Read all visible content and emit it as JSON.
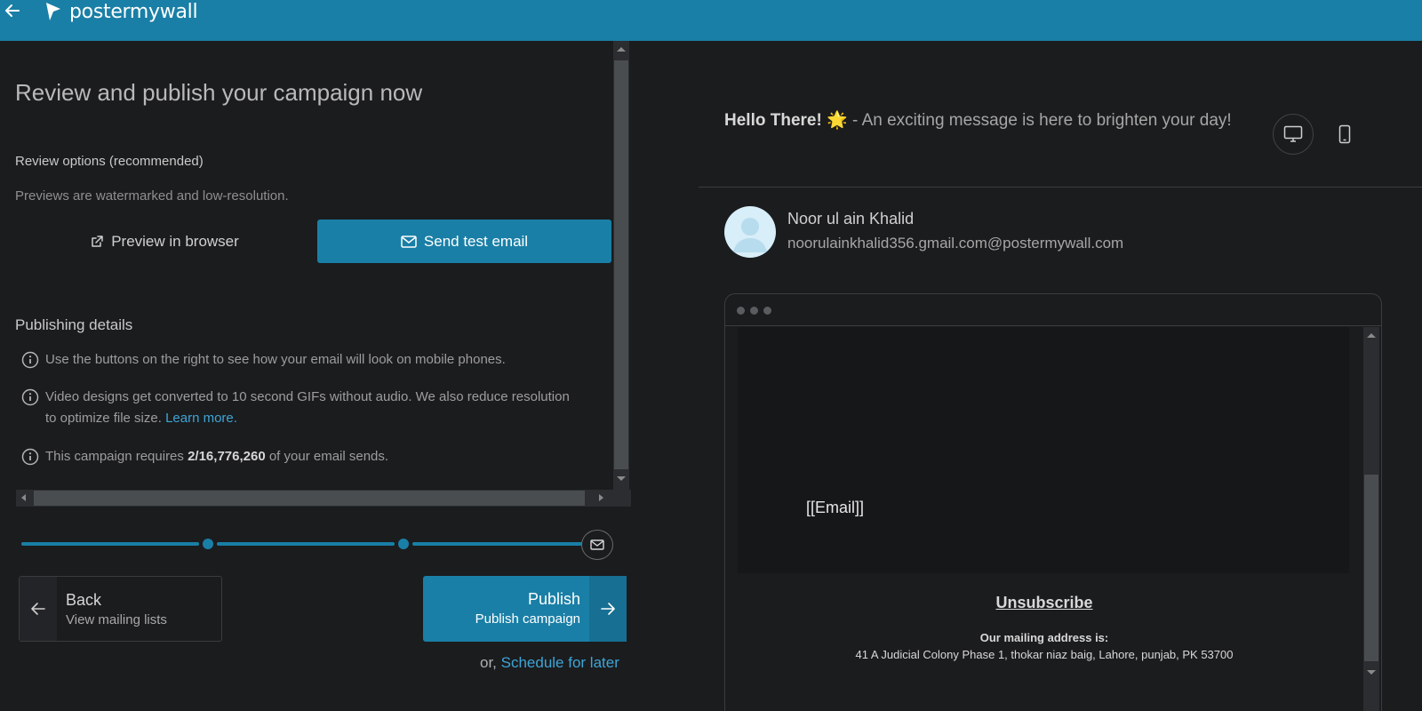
{
  "header": {
    "logo_text": "postermywall",
    "brand_color": "#1a7fa6"
  },
  "left": {
    "title": "Review and publish your campaign now",
    "review_label": "Review options (recommended)",
    "review_sub": "Previews are watermarked and low-resolution.",
    "preview_button": "Preview in browser",
    "send_test_button": "Send test email",
    "publishing_title": "Publishing details",
    "info": {
      "mobile": "Use the buttons on the right to see how your email will look on mobile phones.",
      "video_line1": "Video designs get converted to 10 second GIFs without audio. We also reduce resolution",
      "video_line2": "to optimize file size. ",
      "learn_more": "Learn more.",
      "sends_prefix": "This campaign requires ",
      "sends_count": "2/16,776,260",
      "sends_suffix": " of your email sends."
    }
  },
  "nav": {
    "back_title": "Back",
    "back_sub": "View mailing lists",
    "publish_title": "Publish",
    "publish_sub": "Publish campaign",
    "schedule_prefix": "or, ",
    "schedule_link": "Schedule for later"
  },
  "preview": {
    "subject_bold": "Hello There! 🌟",
    "subject_rest": " - An exciting message is here to brighten your day!",
    "sender_name": "Noor ul ain Khalid",
    "sender_email": "noorulainkhalid356.gmail.com@postermywall.com",
    "email_placeholder": "[[Email]]",
    "unsubscribe": "Unsubscribe",
    "mailing_label": "Our mailing address is:",
    "mailing_address": "41 A Judicial Colony Phase 1, thokar niaz baig, Lahore, punjab, PK 53700"
  }
}
